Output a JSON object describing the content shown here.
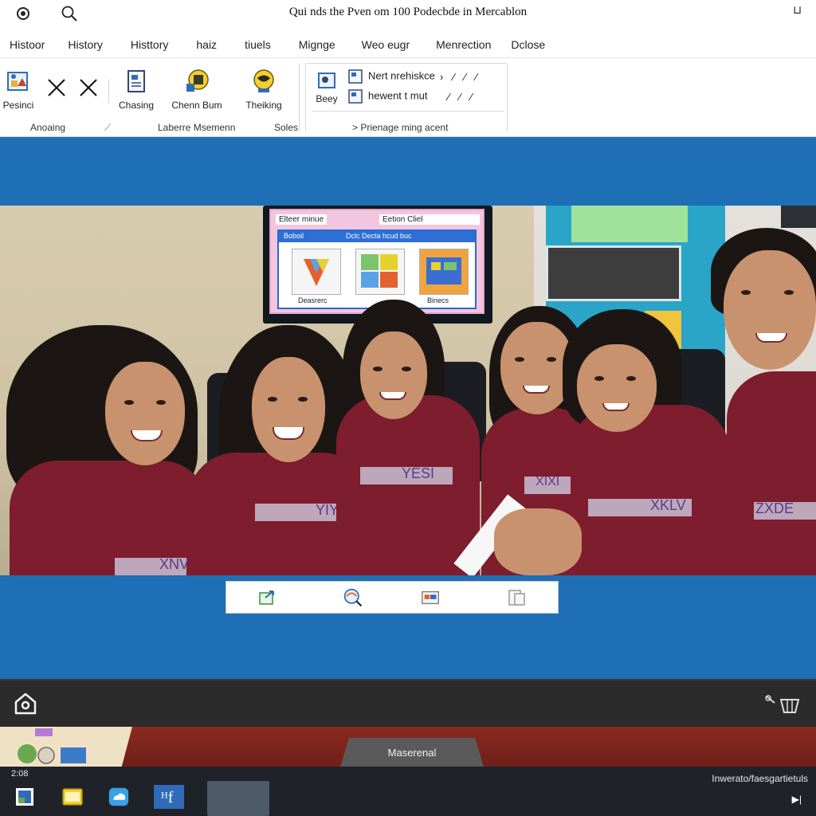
{
  "window": {
    "title": "Qui nds the Pven om 100 Podecbde in Mercablon",
    "control": "⊔"
  },
  "menu": {
    "items": [
      "Histoor",
      "History",
      "Histtory",
      "haiz",
      "tiuels",
      "Mignge",
      "Weo eugr",
      "Menrection",
      "Dclose"
    ]
  },
  "ribbon": {
    "buttons": {
      "pesinci": "Pesinci",
      "chasing": "Chasing",
      "chem_bum": "Chenn Bum",
      "theking": "Theiking",
      "beey": "Beey"
    },
    "groups": {
      "anoaing": "Anoaing",
      "laberre": "Laberre Msemenn",
      "soles": "Soles",
      "prienage": "> Prienage ming acent"
    },
    "rows": {
      "row1": "Nert nrehiskce",
      "row2": "hewent t mut"
    }
  },
  "monitor": {
    "tab_left": "Elteer minue",
    "tab_right": "Eetion Cliel",
    "head_left": "Boboil",
    "head_right": "Dclc Decta hcud buc",
    "tiles": [
      "Deasrerc",
      "",
      "Binecs"
    ]
  },
  "shirts": {
    "s1": "XNV",
    "s2": "YIY",
    "s3": "YESI",
    "s4": "XIXI",
    "s5": "XKLV",
    "s6": "ZXDE"
  },
  "desk": {
    "tab_label": "Maserenal"
  },
  "taskbar": {
    "time": "2:08",
    "status": "Inwerato/faesgartietuls",
    "play_icon": "▶|"
  },
  "colors": {
    "stage_blue": "#1e6fb5",
    "shirt_maroon": "#7d1d2e",
    "taskbar": "#1f2329"
  }
}
